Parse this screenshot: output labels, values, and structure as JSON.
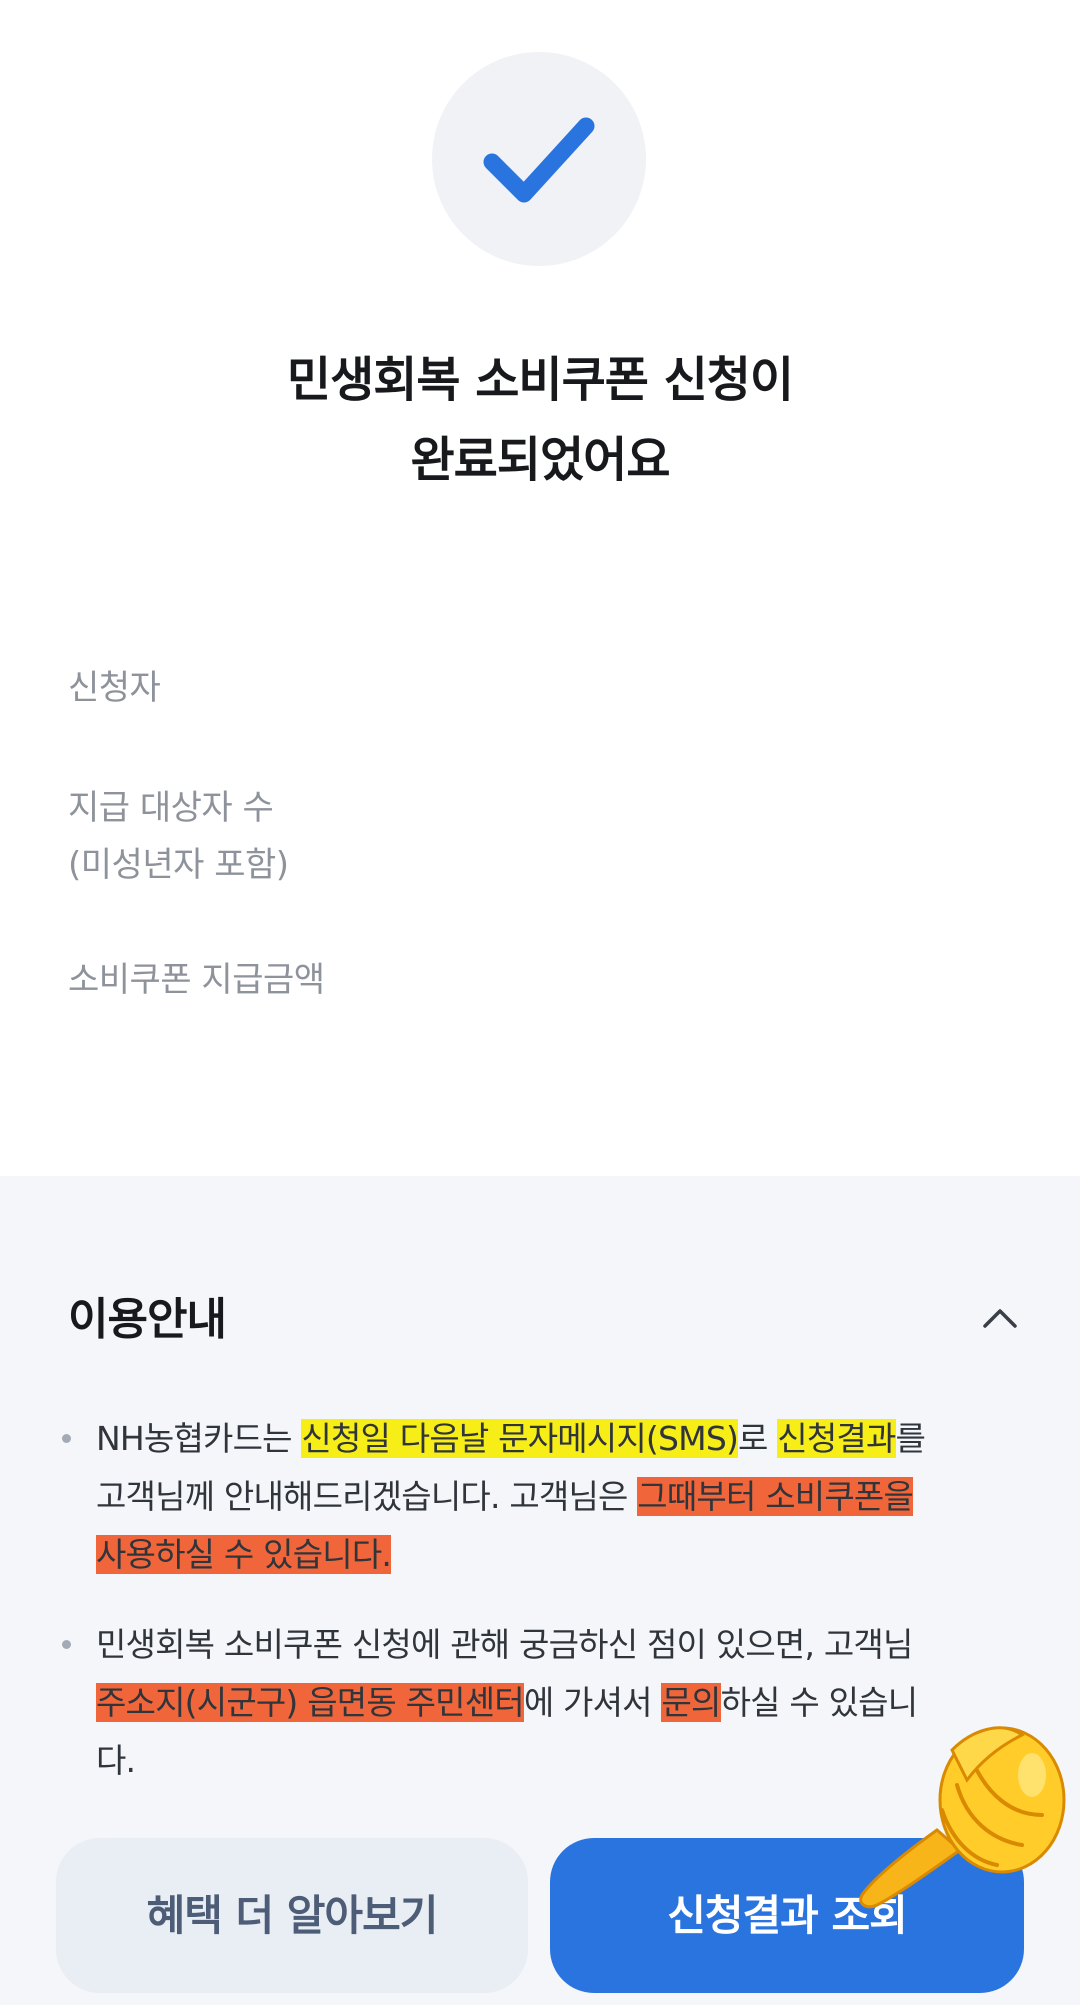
{
  "result": {
    "title_line1": "민생회복 소비쿠폰 신청이",
    "title_line2": "완료되었어요"
  },
  "info": {
    "applicant_label": "신청자",
    "recipients_label_line1": "지급 대상자 수",
    "recipients_label_line2": "(미성년자 포함)",
    "amount_label": "소비쿠폰 지급금액"
  },
  "guide": {
    "title": "이용안내",
    "bullet1": {
      "l1_a": "NH농협카드는 ",
      "l1_b": "신청일 다음날 문자메시지(SMS)",
      "l1_c": "로 ",
      "l1_d": "신청결과",
      "l1_e": "를",
      "l2_a": "고객님께 안내해드리겠습니다. 고객님은 ",
      "l2_b": "그때부터 소비쿠폰을",
      "l3_a": "사용하실 수 있습니다."
    },
    "bullet2": {
      "l1_a": "민생회복 소비쿠폰 신청에 관해 궁금하신 점이 있으면, 고객님",
      "l2_a": "주소지(시군구) 읍면동 주민센터",
      "l2_b": "에 가셔서 ",
      "l2_c": "문의",
      "l2_d": "하실 수 있습니",
      "l3_a": "다."
    }
  },
  "buttons": {
    "more_benefits": "혜택 더 알아보기",
    "check_result": "신청결과 조회"
  },
  "colors": {
    "accent": "#2a74e0",
    "highlight_yellow": "#f7ee17",
    "highlight_red": "#f0663a"
  },
  "icons": {
    "status": "checkmark-icon",
    "collapse": "chevron-up-icon",
    "pointer": "pointing-hand-icon"
  }
}
